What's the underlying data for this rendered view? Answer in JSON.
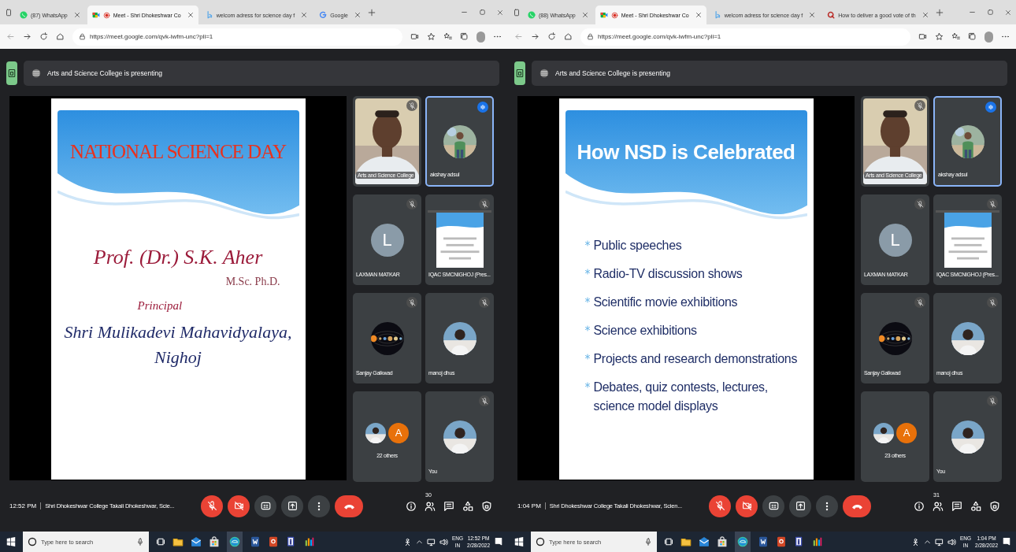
{
  "panels": [
    {
      "tabs": [
        {
          "kind": "chat",
          "title": "(87) WhatsApp",
          "selected": false,
          "recording": false
        },
        {
          "kind": "meet",
          "title": "Meet - Shri Dhokeshwar Co",
          "selected": true,
          "recording": true
        },
        {
          "kind": "doc",
          "title": "welcom adress for science day f",
          "selected": false,
          "recording": false
        },
        {
          "kind": "search",
          "title": "Google",
          "selected": false,
          "recording": false
        }
      ],
      "url": "https://meet.google.com/qvk-iwfm-unc?pli=1",
      "banner": "Arts and Science College is presenting",
      "slide": {
        "kind": "title",
        "heading": "NATIONAL SCIENCE DAY",
        "lines": [
          {
            "kind": "name",
            "text": "Prof. (Dr.) S.K. Aher"
          },
          {
            "kind": "degree",
            "text": "M.Sc. Ph.D."
          },
          {
            "kind": "role",
            "text": "Principal"
          },
          {
            "kind": "institution",
            "text": "Shri Mulikadevi Mahavidyalaya,"
          },
          {
            "kind": "institution",
            "text": "Nighoj"
          }
        ]
      },
      "tiles": [
        {
          "kind": "video",
          "name": "Arts and Science College",
          "muted": true,
          "speaking": false
        },
        {
          "name": "akshay adsul",
          "muted": false,
          "speaking": true
        },
        {
          "kind": "letter",
          "name": "LAXMAN MATKAR",
          "letter": "L",
          "color": "#8a9ba8",
          "muted": true,
          "speaking": false
        },
        {
          "kind": "screen",
          "name": "IQAC SMCNIGHOJ (Pres...",
          "muted": true,
          "speaking": false
        },
        {
          "kind": "space",
          "name": "Sanjay Gaikwad",
          "muted": true,
          "speaking": false
        },
        {
          "name": "manoj dhus",
          "muted": true,
          "speaking": false
        },
        {
          "kind": "group",
          "name": "22 others",
          "letter": "A",
          "color": "#e8710a",
          "muted": false,
          "speaking": false
        },
        {
          "name": "You",
          "muted": true,
          "speaking": false
        }
      ],
      "time": "12:52 PM",
      "meeting": "Shri Dhokeshwar College Takali Dhokeshwar, Scie...",
      "mic_on": false,
      "camera_on": false,
      "people_count": "30",
      "taskbar": {
        "search": "Type here to search",
        "language": "ENG",
        "region": "IN",
        "time": "12:52 PM",
        "date": "2/28/2022"
      }
    },
    {
      "tabs": [
        {
          "kind": "chat",
          "title": "(88) WhatsApp",
          "selected": false,
          "recording": false
        },
        {
          "kind": "meet",
          "title": "Meet - Shri Dhokeshwar Co",
          "selected": true,
          "recording": true
        },
        {
          "kind": "doc",
          "title": "welcom adress for science day f",
          "selected": false,
          "recording": false
        },
        {
          "kind": "q",
          "title": "How to deliver a good vote of th",
          "selected": false,
          "recording": false
        }
      ],
      "url": "https://meet.google.com/qvk-iwfm-unc?pli=1",
      "banner": "Arts and Science College is presenting",
      "slide": {
        "kind": "bullets",
        "heading": "How NSD is Celebrated",
        "lines": [
          {
            "kind": "bullet",
            "text": "Public speeches"
          },
          {
            "kind": "bullet",
            "text": "Radio-TV discussion shows"
          },
          {
            "kind": "bullet",
            "text": "Scientific movie exhibitions"
          },
          {
            "kind": "bullet",
            "text": "Science exhibitions"
          },
          {
            "kind": "bullet",
            "text": "Projects and research demonstrations"
          },
          {
            "kind": "bullet",
            "text": "Debates, quiz contests, lectures, science model displays"
          }
        ]
      },
      "tiles": [
        {
          "kind": "video",
          "name": "Arts and Science College",
          "muted": true,
          "speaking": false
        },
        {
          "name": "akshay adsul",
          "muted": false,
          "speaking": true
        },
        {
          "kind": "letter",
          "name": "LAXMAN MATKAR",
          "letter": "L",
          "color": "#8a9ba8",
          "muted": true,
          "speaking": false
        },
        {
          "kind": "screen",
          "name": "IQAC SMCNIGHOJ (Pres...",
          "muted": true,
          "speaking": false
        },
        {
          "kind": "space",
          "name": "Sanjay Gaikwad",
          "muted": true,
          "speaking": false
        },
        {
          "name": "manoj dhus",
          "muted": true,
          "speaking": false
        },
        {
          "kind": "group",
          "name": "23 others",
          "letter": "A",
          "color": "#e8710a",
          "muted": false,
          "speaking": false
        },
        {
          "name": "You",
          "muted": true,
          "speaking": false
        }
      ],
      "time": "1:04 PM",
      "meeting": "Shri Dhokeshwar College Takali Dhokeshwar, Scien...",
      "mic_on": false,
      "camera_on": false,
      "people_count": "31",
      "taskbar": {
        "search": "Type here to search",
        "language": "ENG",
        "region": "IN",
        "time": "1:04 PM",
        "date": "2/28/2022"
      }
    }
  ]
}
